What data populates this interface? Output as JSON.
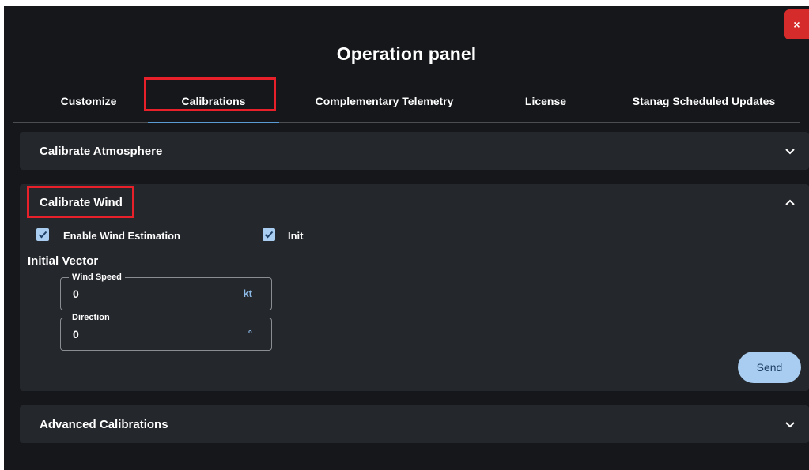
{
  "dialog": {
    "title": "Operation panel",
    "close_label": "×"
  },
  "tabs": [
    {
      "label": "Customize"
    },
    {
      "label": "Calibrations",
      "active": true
    },
    {
      "label": "Complementary Telemetry"
    },
    {
      "label": "License"
    },
    {
      "label": "Stanag Scheduled Updates"
    }
  ],
  "panels": {
    "atmosphere": {
      "title": "Calibrate Atmosphere",
      "expanded": false
    },
    "wind": {
      "title": "Calibrate Wind",
      "expanded": true,
      "enable_wind_estimation": {
        "label": "Enable Wind Estimation",
        "checked": true
      },
      "init": {
        "label": "Init",
        "checked": true
      },
      "initial_vector_label": "Initial Vector",
      "wind_speed": {
        "label": "Wind Speed",
        "value": "0",
        "unit": "kt"
      },
      "direction": {
        "label": "Direction",
        "value": "0",
        "unit": "°"
      },
      "send_label": "Send"
    },
    "advanced": {
      "title": "Advanced Calibrations",
      "expanded": false
    }
  },
  "colors": {
    "background": "#15171b",
    "panel": "#24272c",
    "accent": "#a8cdf0",
    "highlight": "#e8202a",
    "close": "#d62b2b"
  }
}
